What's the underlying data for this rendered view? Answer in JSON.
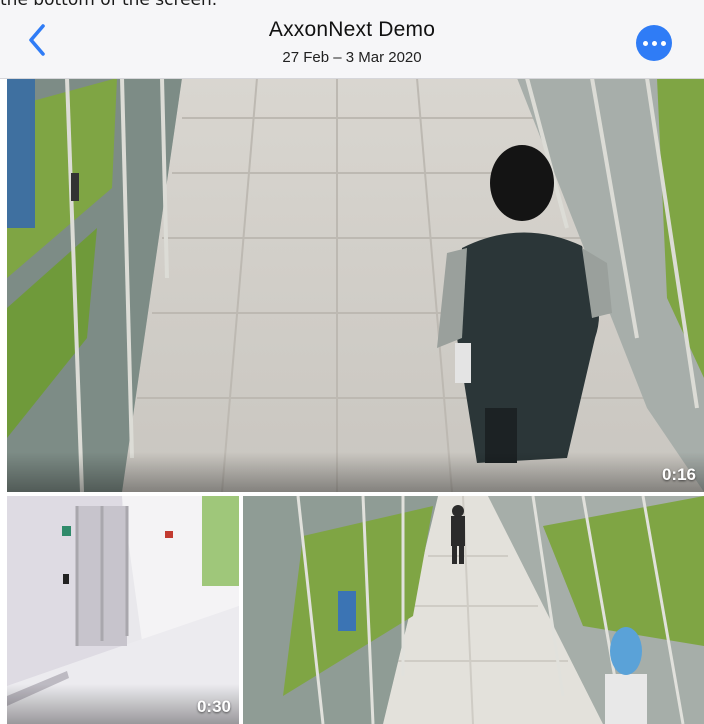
{
  "caption_fragment": "the bottom of the screen.",
  "header": {
    "title": "AxxonNext Demo",
    "date_range": "27 Feb – 3 Mar 2020",
    "back_icon": "chevron-left-icon",
    "more_icon": "ellipsis-icon"
  },
  "clips": [
    {
      "duration": "0:16"
    },
    {
      "duration": "0:30"
    },
    {
      "duration": ""
    }
  ],
  "colors": {
    "accent": "#2f7cf6",
    "header_bg": "#f6f6f8"
  }
}
